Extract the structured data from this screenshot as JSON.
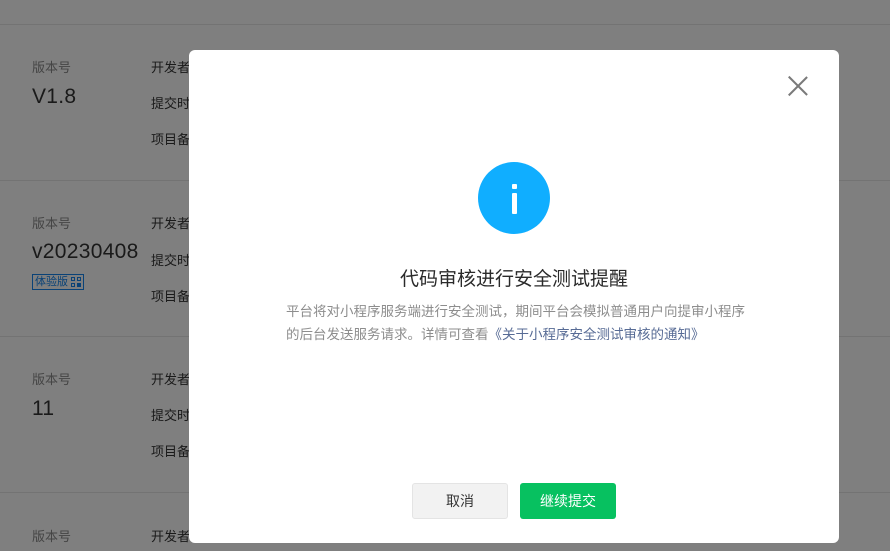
{
  "background": {
    "rows": [
      {
        "label": "版本号",
        "version": "V1.8",
        "tag": "",
        "meta": [
          "开发者",
          "提交时",
          "项目备"
        ]
      },
      {
        "label": "版本号",
        "version": "v20230408",
        "tag": "体验版",
        "meta": [
          "开发者",
          "提交时",
          "项目备"
        ]
      },
      {
        "label": "版本号",
        "version": "11",
        "tag": "",
        "meta": [
          "开发者",
          "提交时",
          "项目备"
        ]
      },
      {
        "label": "版本号",
        "version": "",
        "tag": "",
        "meta": [
          "开发者"
        ]
      }
    ]
  },
  "dialog": {
    "title": "代码审核进行安全测试提醒",
    "description": "平台将对小程序服务端进行安全测试，期间平台会模拟普通用户向提审小程序的后台发送服务请求。详情可查看",
    "link_text": "《关于小程序安全测试审核的通知》",
    "cancel_label": "取消",
    "confirm_label": "继续提交",
    "icon": "info-icon",
    "close_icon": "close-icon"
  },
  "colors": {
    "accent": "#07c160",
    "info": "#10aeff",
    "link": "#576b95",
    "tag": "#1485ee"
  }
}
